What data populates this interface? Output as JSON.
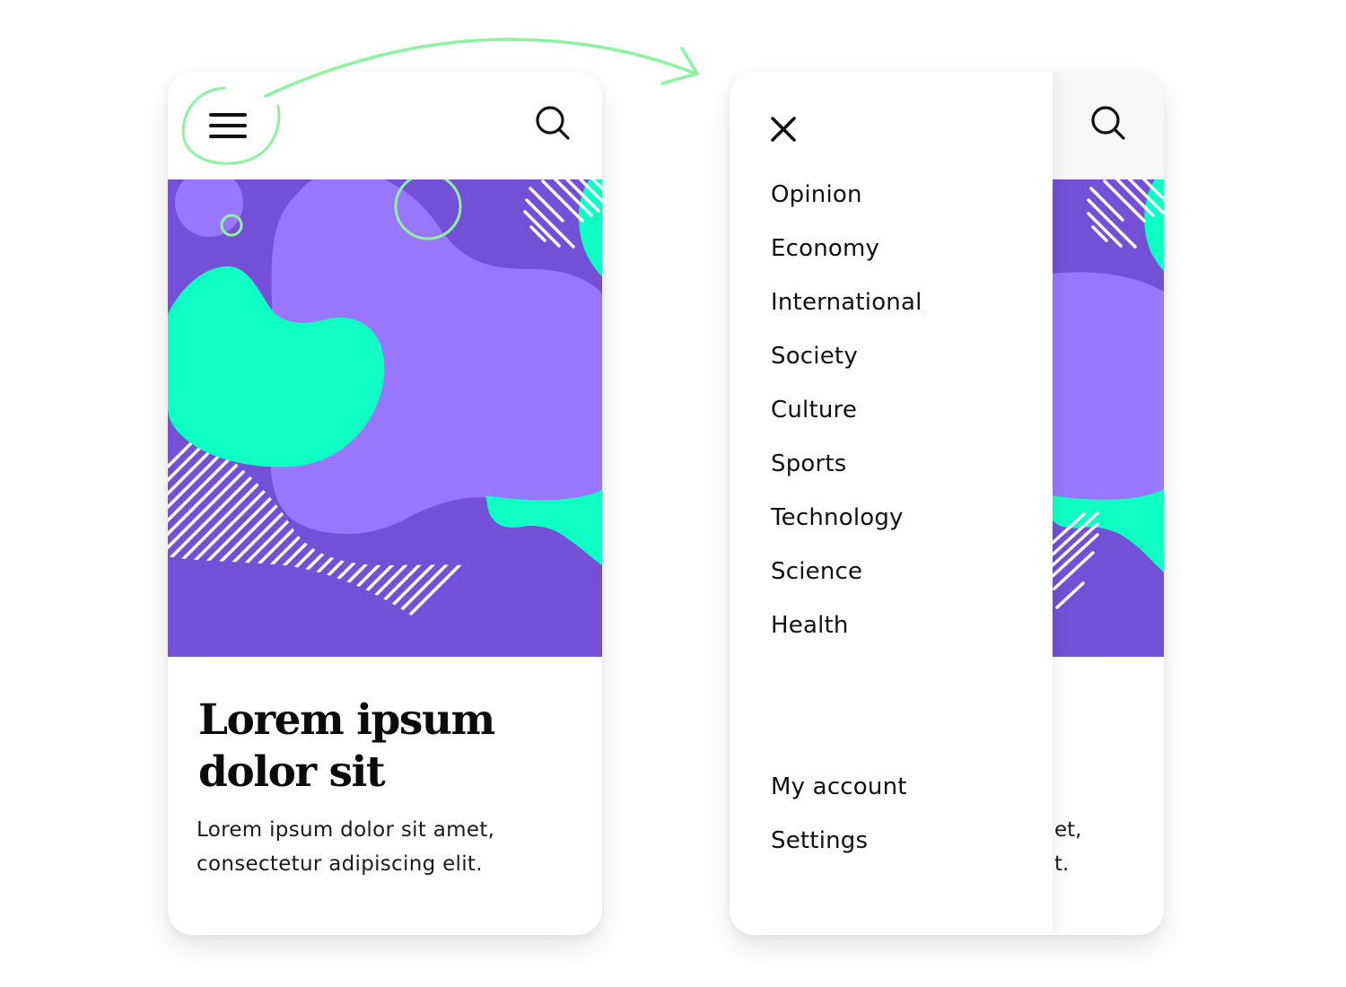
{
  "colors": {
    "purple_dark": "#7450d6",
    "purple_light": "#9877fc",
    "mint": "#10ffc5",
    "annotation_green": "#8ef2a0",
    "text": "#111111"
  },
  "left_screen": {
    "header": {
      "menu_icon": "hamburger-icon",
      "search_icon": "search-icon"
    },
    "hero_image": "abstract-blob-illustration",
    "article": {
      "title": "Lorem ipsum dolor sit",
      "description": "Lorem ipsum dolor sit amet, consectetur adipiscing elit."
    }
  },
  "right_screen": {
    "drawer": {
      "close_icon": "close-icon",
      "menu_items": [
        {
          "label": "Opinion"
        },
        {
          "label": "Economy"
        },
        {
          "label": "International"
        },
        {
          "label": "Society"
        },
        {
          "label": "Culture"
        },
        {
          "label": "Sports"
        },
        {
          "label": "Technology"
        },
        {
          "label": "Science"
        },
        {
          "label": "Health"
        }
      ],
      "account_items": [
        {
          "label": "My account"
        },
        {
          "label": "Settings"
        }
      ]
    },
    "background_page": {
      "search_icon": "search-icon",
      "description_fragment_line1": "et,",
      "description_fragment_line2": "t."
    }
  },
  "annotation": {
    "type": "hand-drawn-arrow",
    "from": "hamburger-icon",
    "to": "right_screen"
  }
}
